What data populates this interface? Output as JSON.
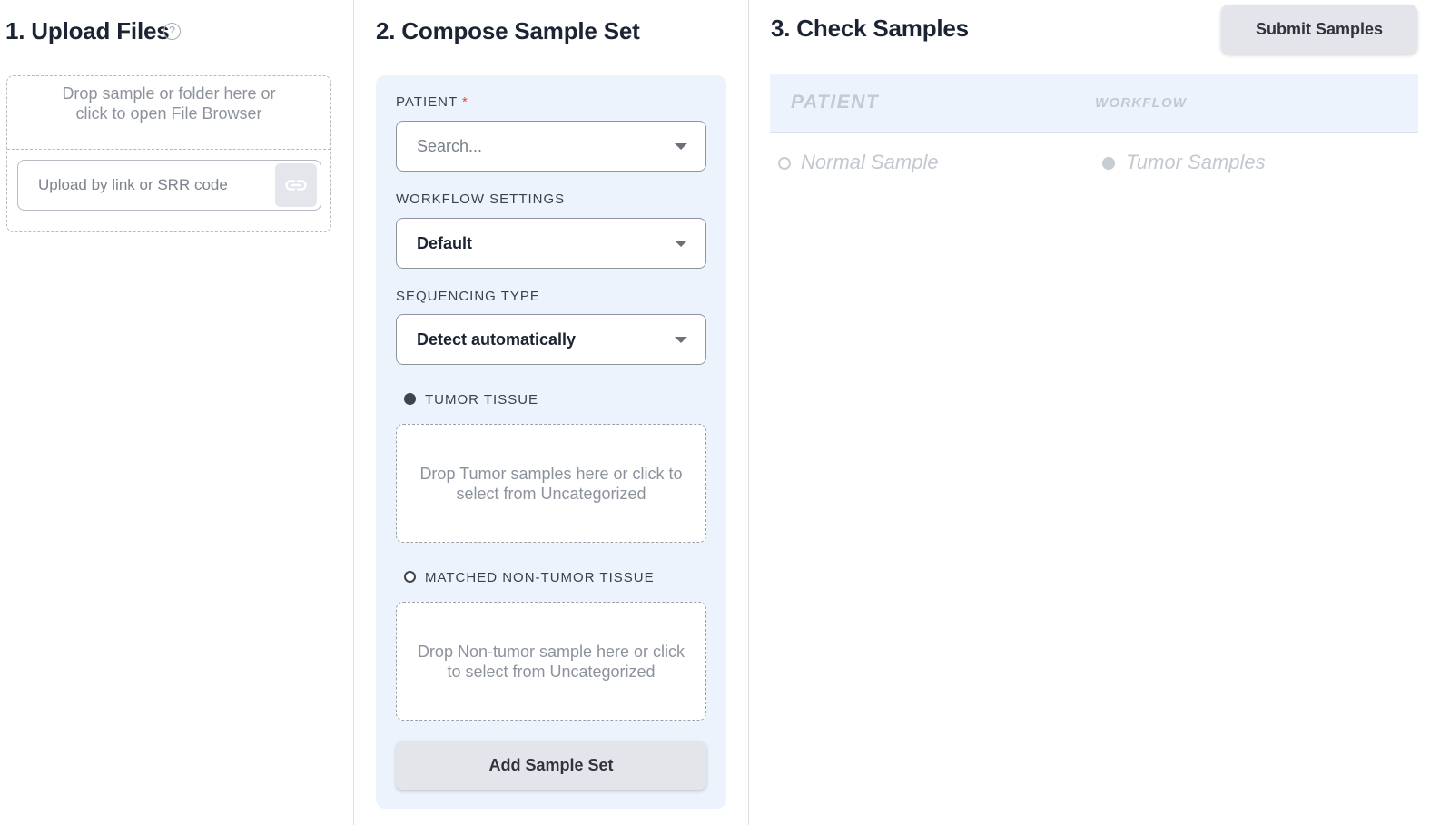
{
  "upload": {
    "title": "1. Upload Files",
    "help_icon": "question-circle-icon",
    "drop_text": "Drop sample or folder here or click to open File Browser",
    "link_placeholder": "Upload by link or SRR code",
    "link_icon": "link-icon"
  },
  "compose": {
    "title": "2. Compose Sample Set",
    "patient_label": "PATIENT",
    "required_mark": "*",
    "patient_placeholder": "Search...",
    "workflow_label": "WORKFLOW SETTINGS",
    "workflow_value": "Default",
    "sequencing_label": "SEQUENCING TYPE",
    "sequencing_value": "Detect automatically",
    "tumor_label": "TUMOR TISSUE",
    "tumor_drop": "Drop Tumor samples here or click to select from Uncategorized",
    "normal_label": "MATCHED NON-TUMOR TISSUE",
    "normal_drop": "Drop Non-tumor sample here or click to select from Uncategorized",
    "add_button": "Add Sample Set"
  },
  "check": {
    "title": "3. Check Samples",
    "submit_button": "Submit Samples",
    "col_patient": "PATIENT",
    "col_workflow": "WORKFLOW",
    "legend_normal": "Normal Sample",
    "legend_tumor": "Tumor Samples"
  },
  "colors": {
    "panel_bg": "#edf3fd",
    "required": "#e0483e",
    "button_bg": "#e3e5ea"
  }
}
